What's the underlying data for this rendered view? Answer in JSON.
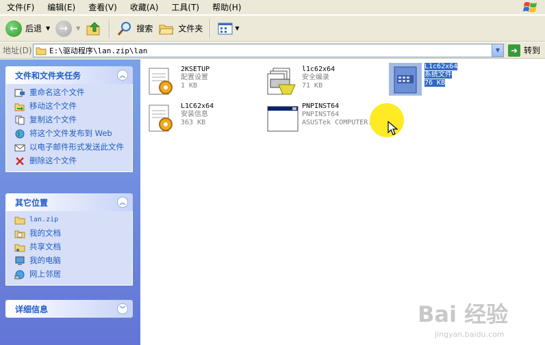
{
  "menu": {
    "file": "文件(F)",
    "edit": "编辑(E)",
    "view": "查看(V)",
    "favorites": "收藏(A)",
    "tools": "工具(T)",
    "help": "帮助(H)"
  },
  "toolbar": {
    "back": "后退",
    "search": "搜索",
    "folders": "文件夹"
  },
  "address": {
    "label": "地址(D)",
    "path": "E:\\驱动程序\\lan.zip\\lan",
    "go": "转到"
  },
  "tasks": {
    "title": "文件和文件夹任务",
    "items": [
      {
        "label": "重命名这个文件",
        "icon": "rename-icon"
      },
      {
        "label": "移动这个文件",
        "icon": "move-icon"
      },
      {
        "label": "复制这个文件",
        "icon": "copy-icon"
      },
      {
        "label": "将这个文件发布到 Web",
        "icon": "publish-web-icon"
      },
      {
        "label": "以电子邮件形式发送此文件",
        "icon": "email-icon"
      },
      {
        "label": "删除这个文件",
        "icon": "delete-icon"
      }
    ]
  },
  "places": {
    "title": "其它位置",
    "items": [
      {
        "label": "lan.zip",
        "icon": "zip-folder-icon"
      },
      {
        "label": "我的文档",
        "icon": "my-documents-icon"
      },
      {
        "label": "共享文档",
        "icon": "shared-documents-icon"
      },
      {
        "label": "我的电脑",
        "icon": "my-computer-icon"
      },
      {
        "label": "网上邻居",
        "icon": "network-icon"
      }
    ]
  },
  "details": {
    "title": "详细信息"
  },
  "files": [
    {
      "name": "2KSETUP",
      "type": "配置设置",
      "info": "1 KB",
      "icon": "config-settings-icon"
    },
    {
      "name": "l1c62x64",
      "type": "安全编录",
      "info": "71 KB",
      "icon": "security-catalog-icon"
    },
    {
      "name": "L1c62x64",
      "type": "系统文件",
      "info": "76 KB",
      "icon": "system-file-icon",
      "selected": true
    },
    {
      "name": "L1C62x64",
      "type": "安装信息",
      "info": "363 KB",
      "icon": "setup-info-icon"
    },
    {
      "name": "PNPINST64",
      "type": "PNPINST64",
      "info": "ASUSTek COMPUTER...",
      "icon": "application-icon"
    }
  ],
  "watermark": {
    "main": "Bai 经验",
    "sub": "jingyan.baidu.com"
  }
}
